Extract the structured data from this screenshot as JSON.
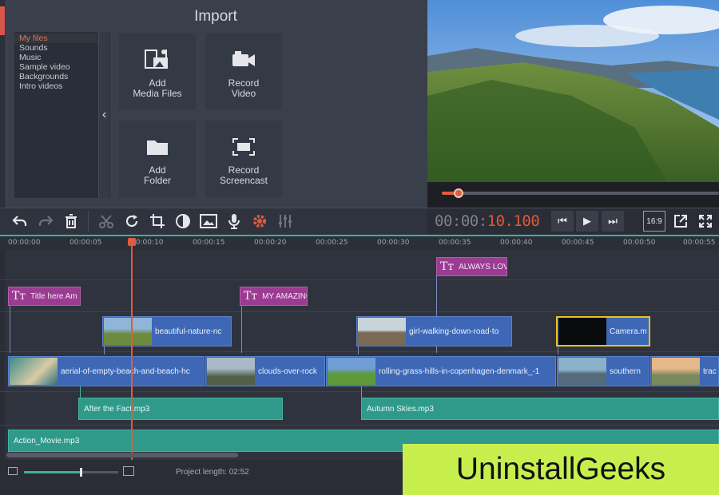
{
  "import": {
    "title": "Import",
    "categories": [
      "My files",
      "Sounds",
      "Music",
      "Sample video",
      "Backgrounds",
      "Intro videos"
    ],
    "collapse_glyph": "‹",
    "tiles": [
      {
        "label": "Add\nMedia Files",
        "icon": "media-files-icon"
      },
      {
        "label": "Record\nVideo",
        "icon": "video-camera-icon"
      },
      {
        "label": "Add\nFolder",
        "icon": "folder-icon"
      },
      {
        "label": "Record\nScreencast",
        "icon": "screencast-icon"
      }
    ]
  },
  "preview": {
    "scrub_progress": 0.06,
    "colors": {
      "sky": "#7fb2e6",
      "forest": "#3f6b2a",
      "water": "#4b8fbe"
    }
  },
  "toolbar": {
    "buttons": [
      "undo-icon",
      "redo-icon",
      "trash-icon",
      "cut-icon",
      "rotate-icon",
      "crop-icon",
      "color-adjust-icon",
      "image-icon",
      "microphone-icon",
      "gear-icon",
      "equalizer-icon"
    ]
  },
  "player": {
    "timecode_gray": "00:00:",
    "timecode_red": "10.100",
    "aspect": "16:9",
    "controls": [
      "prev-icon",
      "play-icon",
      "next-icon"
    ]
  },
  "ruler": {
    "labels": [
      "00:00:00",
      "00:00:05",
      "00:00:10",
      "00:00:15",
      "00:00:20",
      "00:00:25",
      "00:00:30",
      "00:00:35",
      "00:00:40",
      "00:00:45",
      "00:00:50",
      "00:00:55"
    ]
  },
  "timeline": {
    "titles": [
      {
        "icon": "Tт",
        "text": "ALWAYS LOVI"
      },
      {
        "icon": "Tт",
        "text": "Title here Am"
      },
      {
        "icon": "Tт",
        "text": "MY AMAZING"
      }
    ],
    "overlay_clips": [
      "beautiful-nature-nc",
      "girl-walking-down-road-to",
      "Camera.m"
    ],
    "main_clips": [
      "aerial-of-empty-beach-and-beach-hc",
      "clouds-over-rock",
      "rolling-grass-hills-in-copenhagen-denmark_-1",
      "southern",
      "trac"
    ],
    "audio_clips": [
      "After the Fact.mp3",
      "Autumn Skies.mp3",
      "Action_Movie.mp3"
    ]
  },
  "status": {
    "project_length": "Project length:  02:52",
    "zoom_level": 0.6
  },
  "watermark": "UninstallGeeks",
  "accent_colors": {
    "orange": "#e25a3c",
    "teal": "#3ab29a",
    "title_clip": "#9b3c92",
    "video_clip": "#3e68b6",
    "audio_clip": "#2f9a8a"
  }
}
